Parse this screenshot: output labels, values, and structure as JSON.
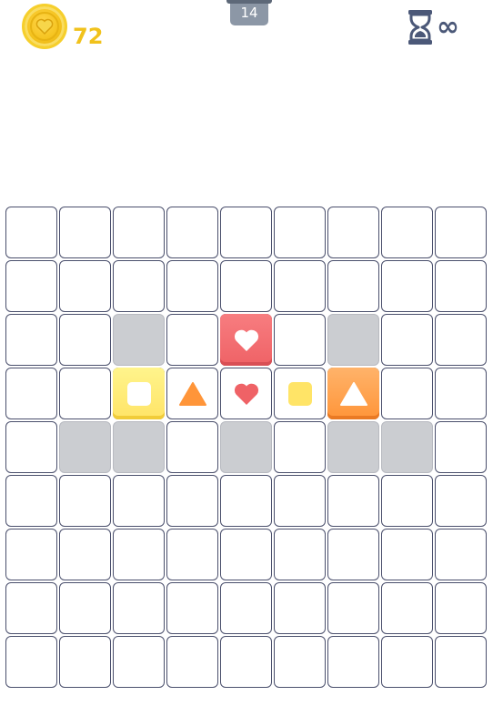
{
  "hud": {
    "coins": "72",
    "level": "14",
    "timer": "∞",
    "coin_icon": "heart-coin-icon",
    "timer_icon": "hourglass-icon"
  },
  "colors": {
    "red": "#ef6266",
    "yellow": "#ffe467",
    "orange": "#ff9539",
    "gray_cell": "#cbcdd1",
    "grid_line": "#4a4f6c",
    "coin": "#f1c21c"
  },
  "board": {
    "rows": 9,
    "cols": 9,
    "gray_cells": [
      [
        2,
        2
      ],
      [
        2,
        6
      ],
      [
        4,
        1
      ],
      [
        4,
        2
      ],
      [
        4,
        4
      ],
      [
        4,
        6
      ],
      [
        4,
        7
      ]
    ],
    "pieces": [
      {
        "row": 2,
        "col": 4,
        "tile": "red",
        "symbol": "heart",
        "symbol_color": "white"
      },
      {
        "row": 3,
        "col": 2,
        "tile": "yellow",
        "symbol": "square",
        "symbol_color": "white"
      },
      {
        "row": 3,
        "col": 3,
        "tile": "none",
        "symbol": "triangle",
        "symbol_color": "orange"
      },
      {
        "row": 3,
        "col": 4,
        "tile": "none",
        "symbol": "heart",
        "symbol_color": "red"
      },
      {
        "row": 3,
        "col": 5,
        "tile": "none",
        "symbol": "square",
        "symbol_color": "yellow"
      },
      {
        "row": 3,
        "col": 6,
        "tile": "orange",
        "symbol": "triangle",
        "symbol_color": "white"
      }
    ]
  }
}
